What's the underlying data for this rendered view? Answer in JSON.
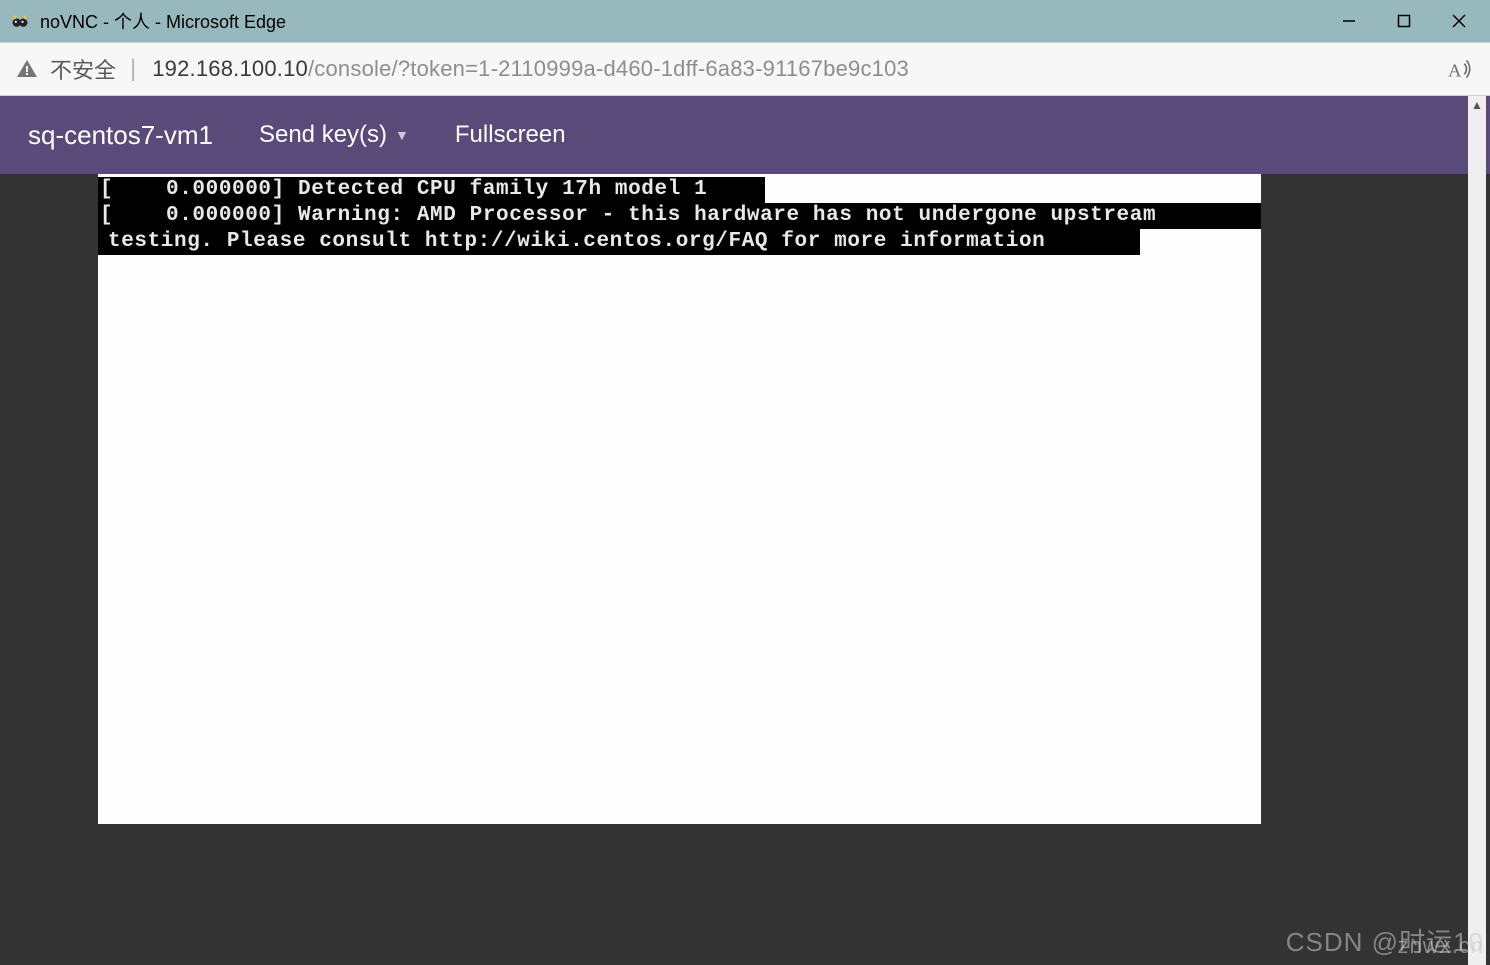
{
  "window": {
    "title": "noVNC - 个人 - Microsoft Edge"
  },
  "addressbar": {
    "security_label": "不安全",
    "url_host": "192.168.100.10",
    "url_path": "/console/?token=1-2110999a-d460-1dff-6a83-91167be9c103"
  },
  "vnc": {
    "vm_name": "sq-centos7-vm1",
    "send_key_label": "Send key(s)",
    "fullscreen_label": "Fullscreen"
  },
  "console": {
    "line1": "[    0.000000] Detected CPU family 17h model 1",
    "line2": "[    0.000000] Warning: AMD Processor - this hardware has not undergone upstream",
    "line3": "testing. Please consult http://wiki.centos.org/FAQ for more information"
  },
  "watermark": {
    "text_main": "CSDN @时运10",
    "text_overlay": "znwx.cn"
  }
}
